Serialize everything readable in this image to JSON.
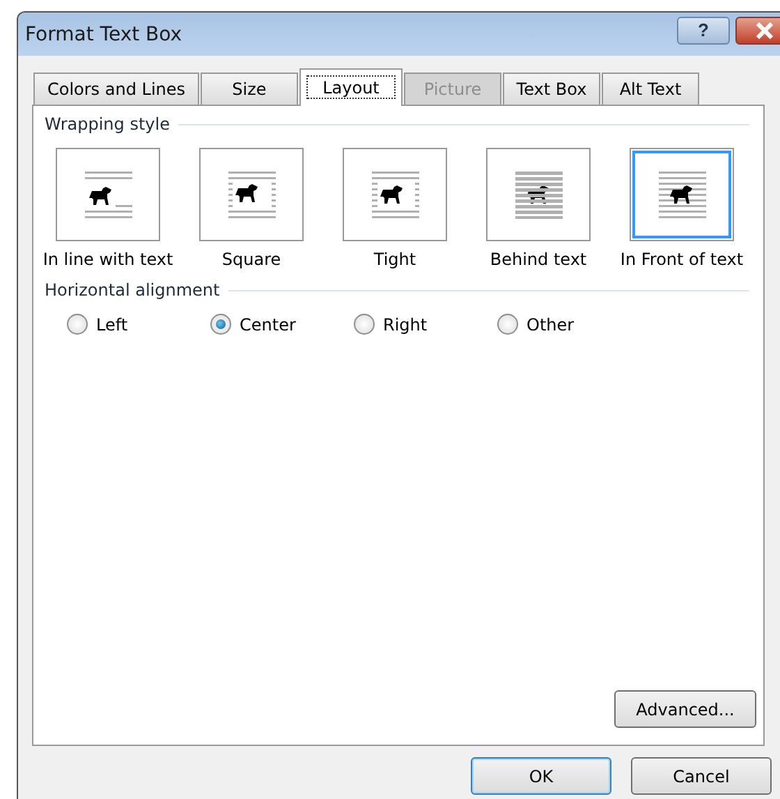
{
  "window": {
    "title": "Format Text Box",
    "help_label": "?"
  },
  "tabs": [
    {
      "label": "Colors and Lines",
      "selected": false,
      "disabled": false
    },
    {
      "label": "Size",
      "selected": false,
      "disabled": false
    },
    {
      "label": "Layout",
      "selected": true,
      "disabled": false
    },
    {
      "label": "Picture",
      "selected": false,
      "disabled": true
    },
    {
      "label": "Text Box",
      "selected": false,
      "disabled": false
    },
    {
      "label": "Alt Text",
      "selected": false,
      "disabled": false
    }
  ],
  "wrapping_style": {
    "heading": "Wrapping style",
    "options": [
      {
        "kind": "inline",
        "label": "In line with text",
        "selected": false
      },
      {
        "kind": "square",
        "label": "Square",
        "selected": false
      },
      {
        "kind": "tight",
        "label": "Tight",
        "selected": false
      },
      {
        "kind": "behind",
        "label": "Behind text",
        "selected": false
      },
      {
        "kind": "front",
        "label": "In Front of text",
        "selected": true
      }
    ]
  },
  "horizontal_alignment": {
    "heading": "Horizontal alignment",
    "options": [
      {
        "label": "Left",
        "selected": false
      },
      {
        "label": "Center",
        "selected": true
      },
      {
        "label": "Right",
        "selected": false
      },
      {
        "label": "Other",
        "selected": false
      }
    ]
  },
  "advanced_button": "Advanced...",
  "buttons": [
    {
      "label": "OK",
      "default": true
    },
    {
      "label": "Cancel",
      "default": false
    }
  ]
}
